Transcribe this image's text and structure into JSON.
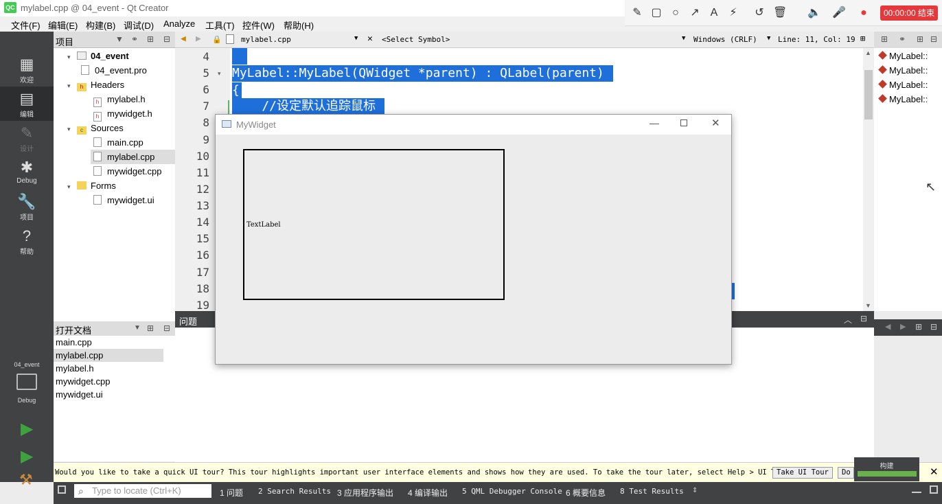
{
  "window": {
    "title": "mylabel.cpp @ 04_event - Qt Creator",
    "logo": "QC"
  },
  "recorder": {
    "timer": "00:00:00 结束"
  },
  "menu": [
    "文件(F)",
    "编辑(E)",
    "构建(B)",
    "调试(D)",
    "Analyze",
    "工具(T)",
    "控件(W)",
    "帮助(H)"
  ],
  "modes": [
    {
      "label": "欢迎",
      "icon": "grid-icon"
    },
    {
      "label": "编辑",
      "icon": "edit-icon"
    },
    {
      "label": "设计",
      "icon": "pencil-icon"
    },
    {
      "label": "Debug",
      "icon": "bug-icon"
    },
    {
      "label": "项目",
      "icon": "wrench-icon"
    },
    {
      "label": "帮助",
      "icon": "help-icon"
    }
  ],
  "kit": {
    "project": "04_event",
    "mode": "Debug"
  },
  "project_panel": {
    "title": "项目",
    "tree": [
      {
        "label": "04_event",
        "level": 0,
        "type": "project",
        "bold": true,
        "arrow": "▾"
      },
      {
        "label": "04_event.pro",
        "level": 1,
        "type": "pro"
      },
      {
        "label": "Headers",
        "level": 1,
        "type": "folder",
        "arrow": "▾"
      },
      {
        "label": "mylabel.h",
        "level": 2,
        "type": "h"
      },
      {
        "label": "mywidget.h",
        "level": 2,
        "type": "h"
      },
      {
        "label": "Sources",
        "level": 1,
        "type": "folder",
        "arrow": "▾"
      },
      {
        "label": "main.cpp",
        "level": 2,
        "type": "cpp"
      },
      {
        "label": "mylabel.cpp",
        "level": 2,
        "type": "cpp",
        "selected": true
      },
      {
        "label": "mywidget.cpp",
        "level": 2,
        "type": "cpp"
      },
      {
        "label": "Forms",
        "level": 1,
        "type": "folder",
        "arrow": "▾"
      },
      {
        "label": "mywidget.ui",
        "level": 2,
        "type": "ui"
      }
    ]
  },
  "open_docs": {
    "title": "打开文档",
    "items": [
      "main.cpp",
      "mylabel.cpp",
      "mylabel.h",
      "mywidget.cpp",
      "mywidget.ui"
    ],
    "selected": 1
  },
  "editor": {
    "file": "mylabel.cpp",
    "symbol": "<Select Symbol>",
    "line_ending": "Windows (CRLF)",
    "position": "Line: 11, Col: 19",
    "line_numbers": [
      "4",
      "5",
      "6",
      "7",
      "8",
      "9",
      "10",
      "11",
      "12",
      "13",
      "14",
      "15",
      "16",
      "17",
      "18",
      "19"
    ],
    "code": [
      "",
      "MyLabel::MyLabel(QWidget *parent) : QLabel(parent)",
      "{",
      "    //设定默认追踪鼠标"
    ]
  },
  "outline": {
    "items": [
      "MyLabel::",
      "MyLabel::",
      "MyLabel::",
      "MyLabel::"
    ]
  },
  "issues": {
    "title": "问题"
  },
  "mywidget": {
    "title": "MyWidget",
    "label_text": "TextLabel"
  },
  "tour": {
    "text": "Would you like to take a quick UI tour? This tour highlights important user interface elements and shows how they are used. To take the tour later, select Help > UI Tour.",
    "take": "Take UI Tour",
    "dont": "Do"
  },
  "locator": {
    "placeholder": "Type to locate (Ctrl+K)"
  },
  "status_tabs": [
    "1 问题",
    "2 Search Results",
    "3 应用程序输出",
    "4 编译输出",
    "5 QML Debugger Console",
    "6 概要信息",
    "8 Test Results"
  ],
  "build": {
    "label": "构建",
    "progress": 1.0
  },
  "colors": {
    "sidebar": "#404244",
    "selection": "#1e6fd9",
    "build_ok": "#6ab04c"
  }
}
